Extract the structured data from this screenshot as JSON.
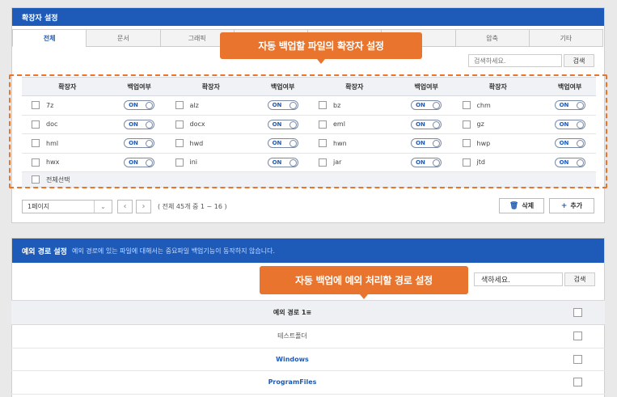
{
  "ext_panel": {
    "title": "확장자 설정",
    "tabs": [
      "전체",
      "문서",
      "그래픽",
      "",
      "",
      "",
      "압축",
      "기타"
    ],
    "search_placeholder": "검색하세요.",
    "search_button": "검색",
    "headers": {
      "ext": "확장자",
      "backup": "백업여부"
    },
    "rows": [
      [
        {
          "ext": "7z",
          "toggle": "ON"
        },
        {
          "ext": "alz",
          "toggle": "ON"
        },
        {
          "ext": "bz",
          "toggle": "ON"
        },
        {
          "ext": "chm",
          "toggle": "ON"
        }
      ],
      [
        {
          "ext": "doc",
          "toggle": "ON"
        },
        {
          "ext": "docx",
          "toggle": "ON"
        },
        {
          "ext": "eml",
          "toggle": "ON"
        },
        {
          "ext": "gz",
          "toggle": "ON"
        }
      ],
      [
        {
          "ext": "hml",
          "toggle": "ON"
        },
        {
          "ext": "hwd",
          "toggle": "ON"
        },
        {
          "ext": "hwn",
          "toggle": "ON"
        },
        {
          "ext": "hwp",
          "toggle": "ON"
        }
      ],
      [
        {
          "ext": "hwx",
          "toggle": "ON"
        },
        {
          "ext": "ini",
          "toggle": "ON"
        },
        {
          "ext": "jar",
          "toggle": "ON"
        },
        {
          "ext": "jtd",
          "toggle": "ON"
        }
      ]
    ],
    "select_all": "전체선택",
    "page_select": "1페이지",
    "page_info": "( 전체 45개 중 1 ~ 16 )",
    "delete_button": "삭제",
    "add_button": "추가"
  },
  "callouts": {
    "ext": "자동 백업할 파일의  확장자 설정",
    "path": "자동 백업에 예외 처리할 경로 설정"
  },
  "path_panel": {
    "title": "예외 경로 설정",
    "note": "예외 경로에 있는 파일에 대해서는 중요파일 백업기능이 동작하지 않습니다.",
    "search_value": "색하세요.",
    "search_button": "검색",
    "column_header": "예외 경로 1≡",
    "rows": [
      "테스트폴더",
      "Windows",
      "ProgramFiles"
    ]
  },
  "colors": {
    "accent": "#1e5bb8",
    "callout": "#e9742d"
  },
  "icons": {
    "delete": "trash-icon",
    "add": "plus-icon",
    "prev": "chevron-left-icon",
    "next": "chevron-right-icon"
  }
}
